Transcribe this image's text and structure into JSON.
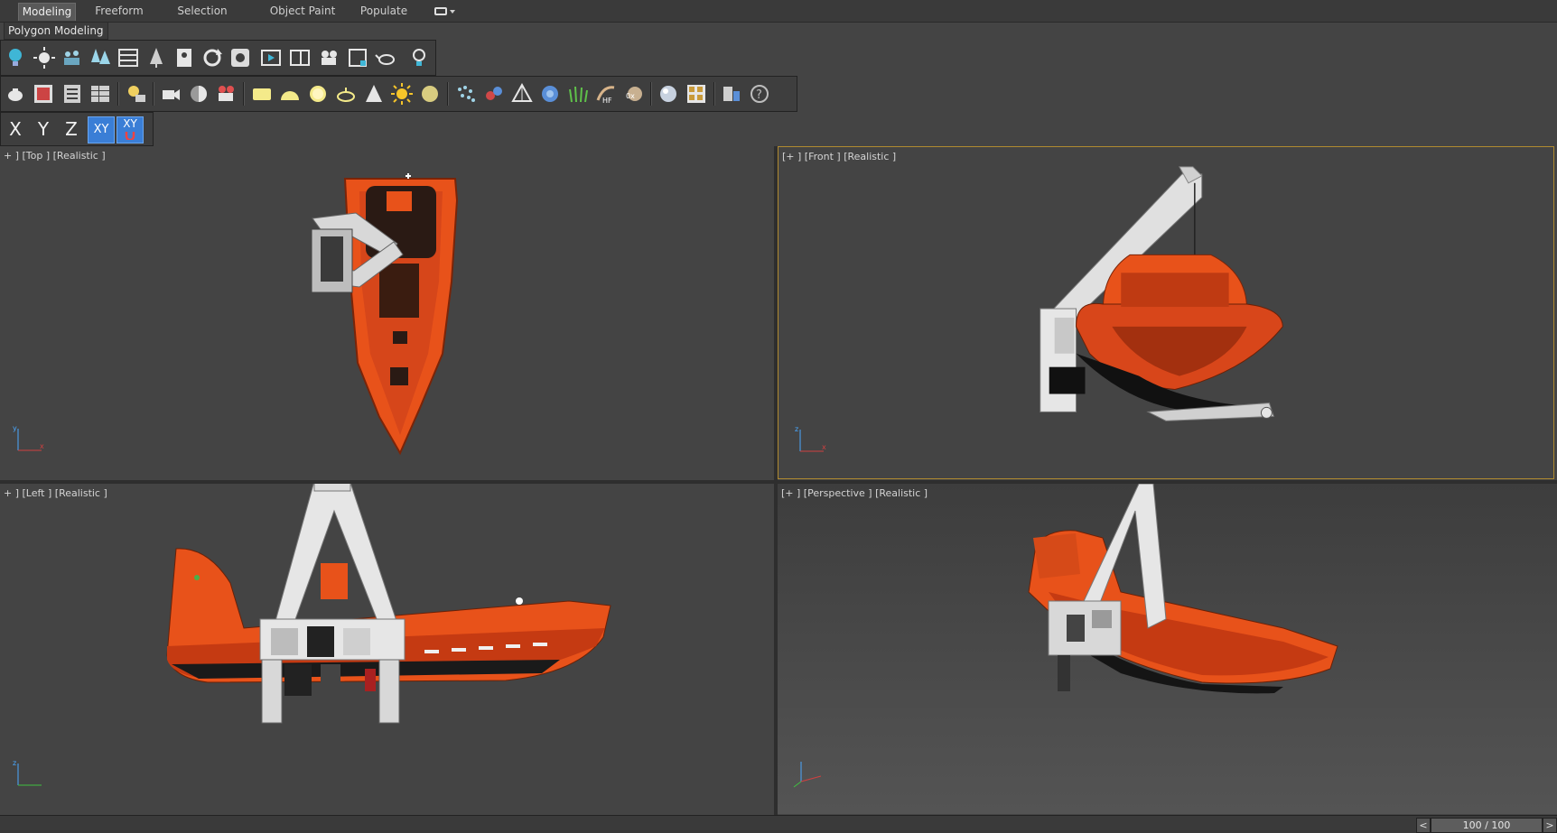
{
  "ribbon": {
    "tabs": [
      {
        "label": "Modeling",
        "active": true
      },
      {
        "label": "Freeform"
      },
      {
        "label": "Selection"
      },
      {
        "label": "Object Paint"
      },
      {
        "label": "Populate"
      }
    ],
    "sub_label": "Polygon Modeling"
  },
  "axis_constraints": {
    "x": "X",
    "y": "Y",
    "z": "Z",
    "xy": "XY",
    "xy_snap": "XY"
  },
  "viewports": {
    "top": {
      "label": "+ ] [Top ] [Realistic ]"
    },
    "front": {
      "label": "[+ ] [Front ] [Realistic ]"
    },
    "left": {
      "label": "+ ] [Left ] [Realistic ]"
    },
    "persp": {
      "label": "[+ ] [Perspective ] [Realistic ]"
    }
  },
  "timeline": {
    "prev": "<",
    "frame": "100 / 100",
    "next": ">"
  },
  "colors": {
    "boat_orange": "#e8521a",
    "crane_white": "#e6e6e6",
    "active_viewport_border": "#b08a30",
    "axis_active_blue": "#3a7ed6"
  }
}
